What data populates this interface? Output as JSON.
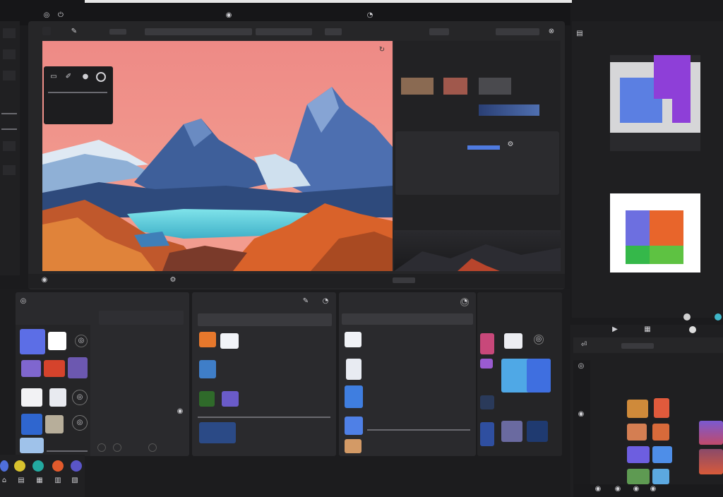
{
  "colors": {
    "bg": "#1b1b1d",
    "panel": "#2a2a2d",
    "sky": "#ee8f88",
    "accent_blue": "#4f7be0",
    "accent_purple": "#8a3fd6",
    "accent_orange": "#e8682c",
    "accent_green": "#3fb44a"
  },
  "icons": {
    "top": [
      "globe-icon",
      "power-icon",
      "bell-icon",
      "user-icon"
    ],
    "left_rail": [
      "thumbnail-icon",
      "layers-icon",
      "brush-icon",
      "image-icon",
      "folder-icon"
    ],
    "dock": [
      "app-icon-blue",
      "app-icon-yellow",
      "app-icon-teal",
      "app-icon-red",
      "app-icon-purple"
    ]
  },
  "main_editor": {
    "tool_popup_label": "",
    "canvas_alt": "mountain landscape with lake at sunset"
  },
  "right_inspector": {
    "title": "",
    "section_title": ""
  },
  "side_panel": {
    "title": ""
  },
  "bottom_panels": {
    "colors_title": "",
    "panel2_title": "",
    "panel3_title": ""
  },
  "bottom_right": {
    "title": "",
    "section": ""
  }
}
